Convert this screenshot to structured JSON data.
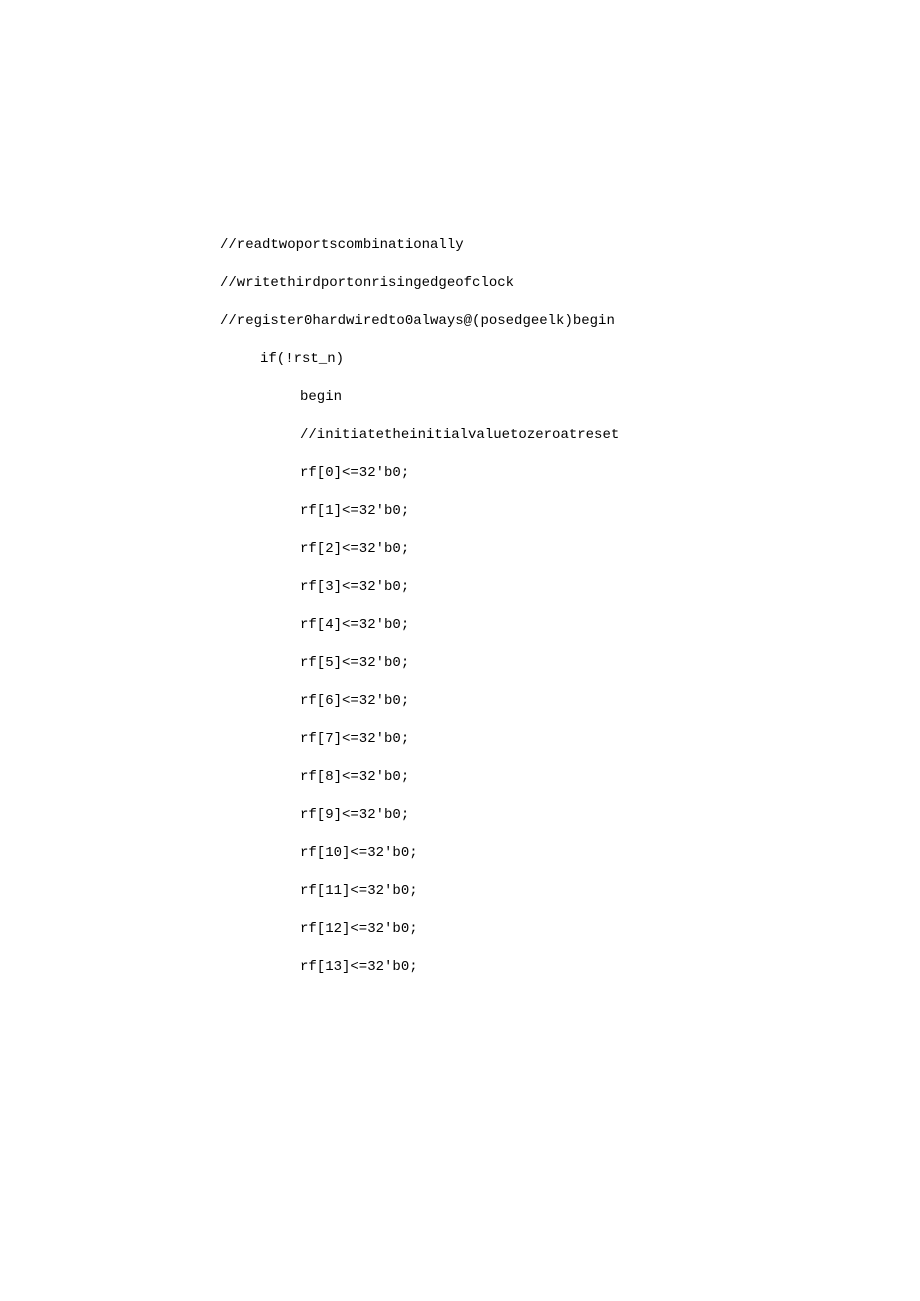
{
  "code": {
    "lines": [
      {
        "indent": 0,
        "text": "//readtwoportscombinationally"
      },
      {
        "indent": 0,
        "text": "//writethirdportonrisingedgeofclock"
      },
      {
        "indent": 0,
        "text": "//register0hardwiredto0always@(posedgeelk)begin"
      },
      {
        "indent": 1,
        "text": "if(!rst_n)"
      },
      {
        "indent": 2,
        "text": "begin"
      },
      {
        "indent": 2,
        "text": "//initiatetheinitialvaluetozeroatreset"
      },
      {
        "indent": 2,
        "text": "rf[0]<=32'b0;"
      },
      {
        "indent": 2,
        "text": "rf[1]<=32'b0;"
      },
      {
        "indent": 2,
        "text": "rf[2]<=32'b0;"
      },
      {
        "indent": 2,
        "text": "rf[3]<=32'b0;"
      },
      {
        "indent": 2,
        "text": "rf[4]<=32'b0;"
      },
      {
        "indent": 2,
        "text": "rf[5]<=32'b0;"
      },
      {
        "indent": 2,
        "text": "rf[6]<=32'b0;"
      },
      {
        "indent": 2,
        "text": "rf[7]<=32'b0;"
      },
      {
        "indent": 2,
        "text": "rf[8]<=32'b0;"
      },
      {
        "indent": 2,
        "text": "rf[9]<=32'b0;"
      },
      {
        "indent": 2,
        "text": "rf[10]<=32'b0;"
      },
      {
        "indent": 2,
        "text": "rf[11]<=32'b0;"
      },
      {
        "indent": 2,
        "text": "rf[12]<=32'b0;"
      },
      {
        "indent": 2,
        "text": "rf[13]<=32'b0;"
      }
    ]
  }
}
